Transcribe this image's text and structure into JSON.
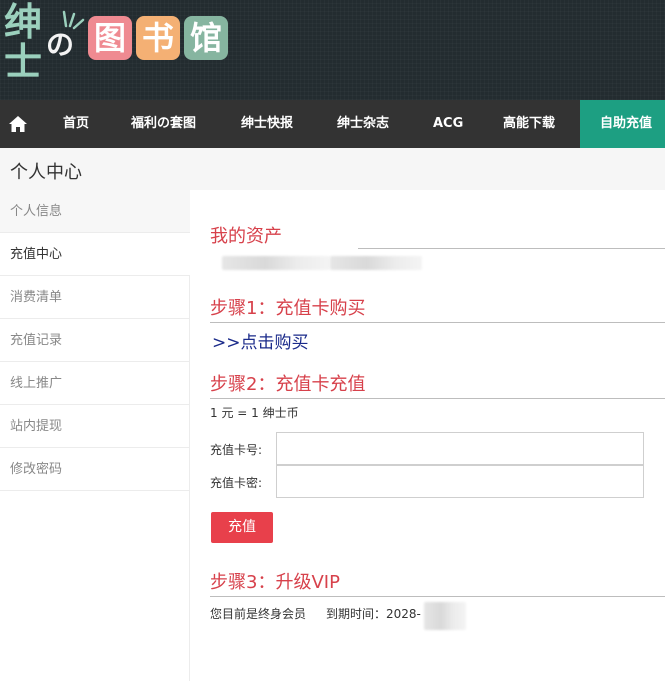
{
  "logo": {
    "vertical_chars": [
      "绅",
      "士"
    ],
    "no_char": "の",
    "tiles": [
      "图",
      "书",
      "馆"
    ]
  },
  "nav": {
    "items": [
      "首页",
      "福利の套图",
      "绅士快报",
      "绅士杂志",
      "ACG",
      "高能下载"
    ],
    "active": "自助充值"
  },
  "page": {
    "title": "个人中心"
  },
  "sidebar": {
    "items": [
      "个人信息",
      "充值中心",
      "消费清单",
      "充值记录",
      "线上推广",
      "站内提现",
      "修改密码"
    ],
    "current": "充值中心"
  },
  "main": {
    "assets_heading": "我的资产",
    "step1_heading": "步骤1：充值卡购买",
    "buy_link": ">>点击购买",
    "step2_heading": "步骤2：充值卡充值",
    "rate": "1 元 = 1 绅士币",
    "card_no_label": "充值卡号:",
    "card_pwd_label": "充值卡密:",
    "card_no_value": "",
    "card_pwd_value": "",
    "submit_label": "充值",
    "step3_heading": "步骤3：升级VIP",
    "vip_status": "您目前是终身会员",
    "expiry_label": "到期时间：2028-"
  },
  "colors": {
    "header_bg": "#232c30",
    "nav_bg": "#333333",
    "nav_active": "#1d9f82",
    "heading_red": "#d7414b",
    "button_red": "#e8404b",
    "link_blue": "#1a2a8a"
  }
}
